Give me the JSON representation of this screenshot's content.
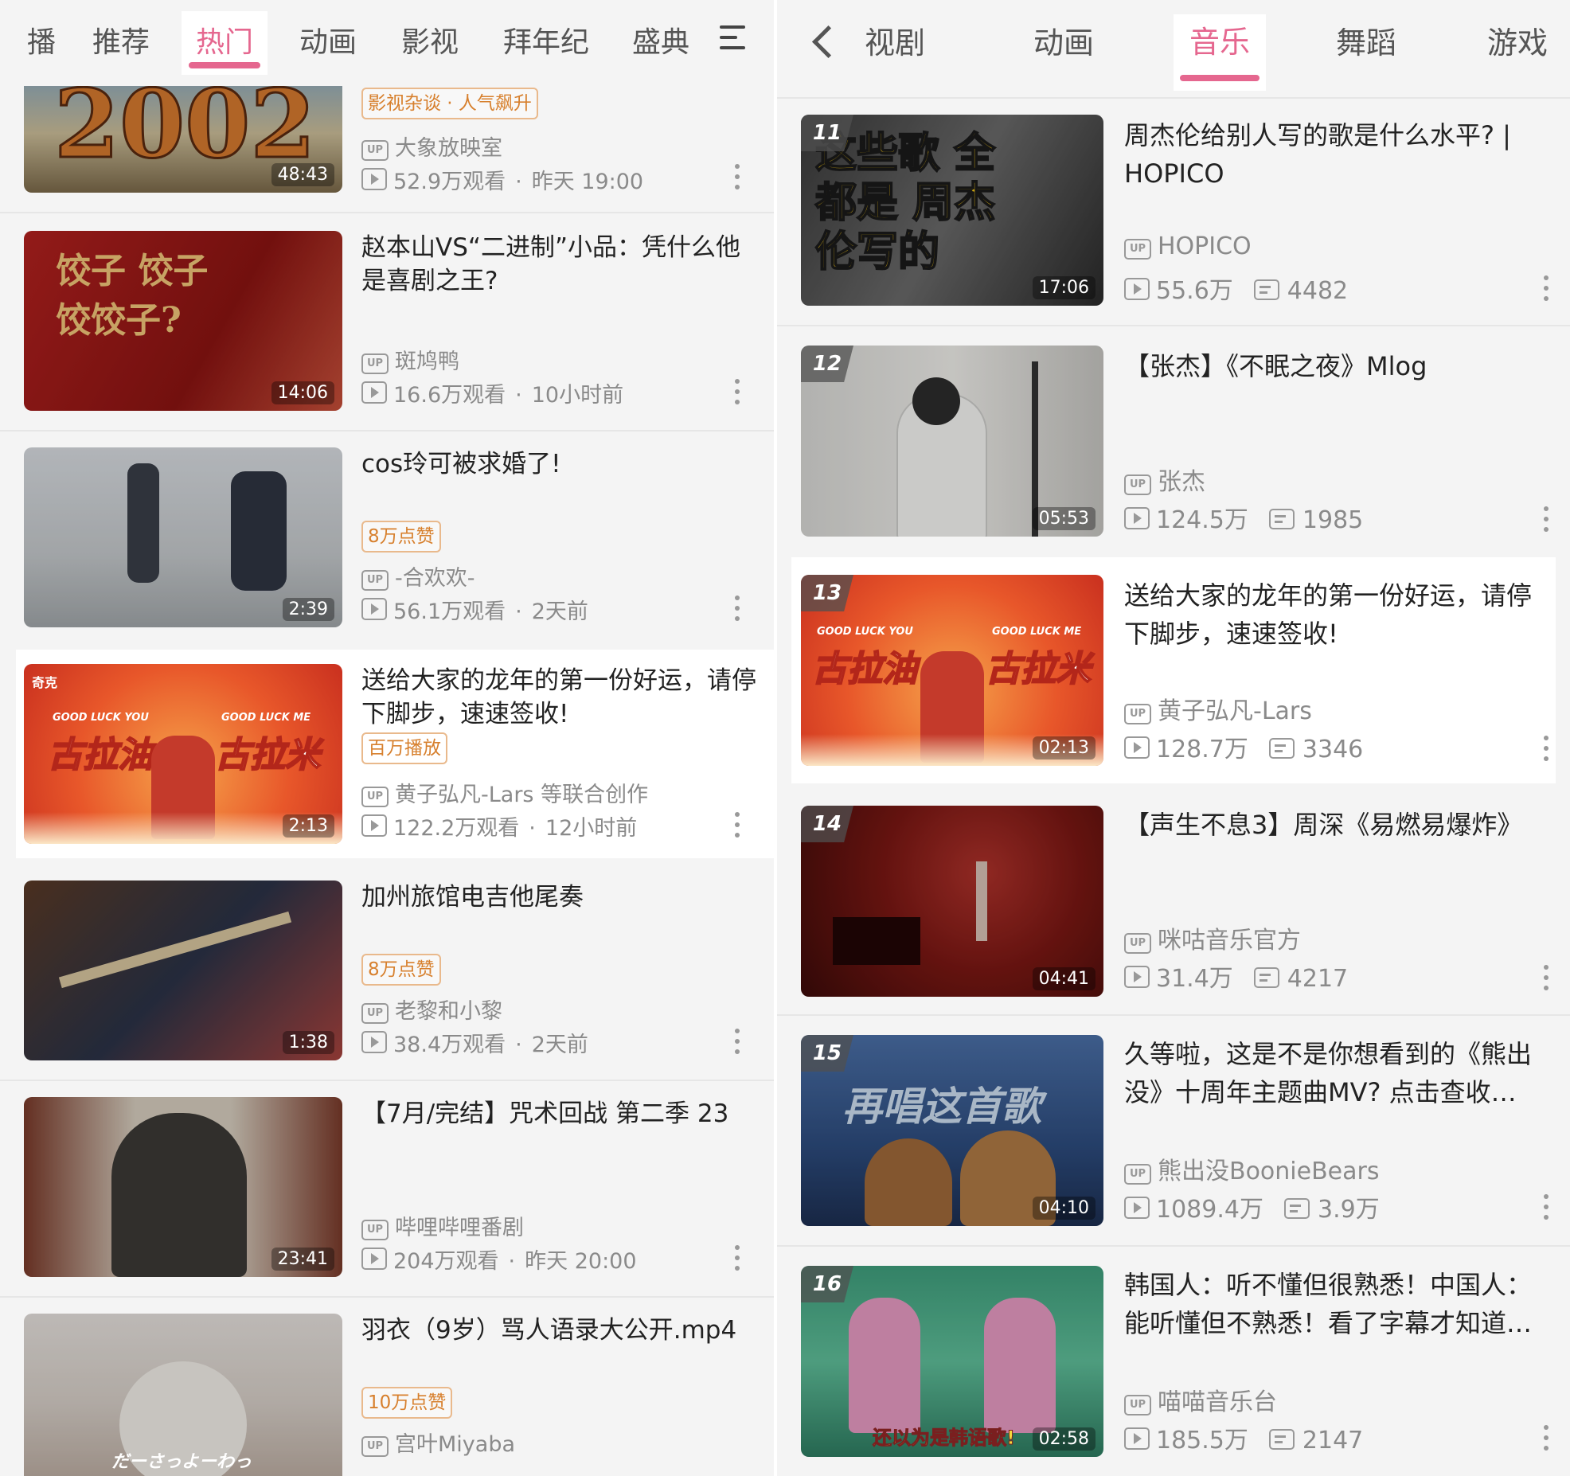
{
  "left": {
    "tabs": [
      {
        "label": "直播",
        "shown": "播"
      },
      {
        "label": "推荐"
      },
      {
        "label": "热门",
        "active": true
      },
      {
        "label": "动画"
      },
      {
        "label": "影视"
      },
      {
        "label": "拜年纪"
      },
      {
        "label": "盛典"
      }
    ],
    "videos": [
      {
        "thumb_text": "2002",
        "tag": "影视杂谈 · 人气飙升",
        "uploader": "大象放映室",
        "views": "52.9万观看",
        "time": "昨天 19:00",
        "duration": "48:43"
      },
      {
        "title": "赵本山VS“二进制”小品：凭什么他是喜剧之王?",
        "thumb_text": "饺子 饺子 饺饺子?",
        "uploader": "斑鸠鸭",
        "views": "16.6万观看",
        "time": "10小时前",
        "duration": "14:06"
      },
      {
        "title": "cos玲可被求婚了!",
        "tag": "8万点赞",
        "uploader": "-合欢欢-",
        "views": "56.1万观看",
        "time": "2天前",
        "duration": "2:39"
      },
      {
        "title": "送给大家的龙年的第一份好运，请停下脚步，速速签收!",
        "tag": "百万播放",
        "uploader": "黄子弘凡-Lars 等联合创作",
        "views": "122.2万观看",
        "time": "12小时前",
        "duration": "2:13",
        "thumb_logo": "奇克",
        "thumb_small_left": "GOOD LUCK YOU",
        "thumb_small_right": "GOOD LUCK ME",
        "thumb_big_left": "古拉油",
        "thumb_big_right": "古拉米"
      },
      {
        "title": "加州旅馆电吉他尾奏",
        "tag": "8万点赞",
        "uploader": "老黎和小黎",
        "views": "38.4万观看",
        "time": "2天前",
        "duration": "1:38"
      },
      {
        "title": "【7月/完结】咒术回战 第二季 23",
        "uploader": "哔哩哔哩番剧",
        "views": "204万观看",
        "time": "昨天 20:00",
        "duration": "23:41"
      },
      {
        "title": "羽衣（9岁）骂人语录大公开.mp4",
        "tag": "10万点赞",
        "uploader": "宫叶Miyaba",
        "thumb_text": "だーさっよーわっ"
      }
    ]
  },
  "right": {
    "tabs": [
      {
        "label": "电视剧",
        "shown": "视剧"
      },
      {
        "label": "动画"
      },
      {
        "label": "音乐",
        "active": true
      },
      {
        "label": "舞蹈"
      },
      {
        "label": "游戏"
      }
    ],
    "videos": [
      {
        "rank": "11",
        "title": "周杰伦给别人写的歌是什么水平? | HOPICO",
        "uploader": "HOPICO",
        "plays": "55.6万",
        "danmaku": "4482",
        "duration": "17:06",
        "thumb_text": "这些歌 全都是 周杰伦写的"
      },
      {
        "rank": "12",
        "title": "【张杰】《不眠之夜》Mlog",
        "uploader": "张杰",
        "plays": "124.5万",
        "danmaku": "1985",
        "duration": "05:53"
      },
      {
        "rank": "13",
        "title": "送给大家的龙年的第一份好运，请停下脚步，速速签收!",
        "uploader": "黄子弘凡-Lars",
        "plays": "128.7万",
        "danmaku": "3346",
        "duration": "02:13",
        "thumb_small_left": "GOOD LUCK YOU",
        "thumb_small_right": "GOOD LUCK ME",
        "thumb_big_left": "古拉油",
        "thumb_big_right": "古拉米"
      },
      {
        "rank": "14",
        "title": "【声生不息3】周深《易燃易爆炸》",
        "uploader": "咪咕音乐官方",
        "plays": "31.4万",
        "danmaku": "4217",
        "duration": "04:41"
      },
      {
        "rank": "15",
        "title": "久等啦，这是不是你想看到的《熊出没》十周年主题曲MV? 点击查收…",
        "uploader": "熊出没BoonieBears",
        "plays": "1089.4万",
        "danmaku": "3.9万",
        "duration": "04:10",
        "thumb_text": "再唱这首歌"
      },
      {
        "rank": "16",
        "title": "韩国人：听不懂但很熟悉！中国人：能听懂但不熟悉！看了字幕才知道…",
        "uploader": "喵喵音乐台",
        "plays": "185.5万",
        "danmaku": "2147",
        "duration": "02:58",
        "thumb_text": "还以为是韩语歌!"
      }
    ]
  },
  "icons": {
    "menu": "menu-icon",
    "back": "chevron-left-icon",
    "more": "more-vertical-icon",
    "uploader": "up-icon",
    "play": "play-count-icon",
    "danmaku": "danmaku-icon"
  },
  "colors": {
    "accent": "#e5678f",
    "tag": "#d7802e",
    "meta": "#8a8a8a",
    "highlight": "#ffffff"
  }
}
